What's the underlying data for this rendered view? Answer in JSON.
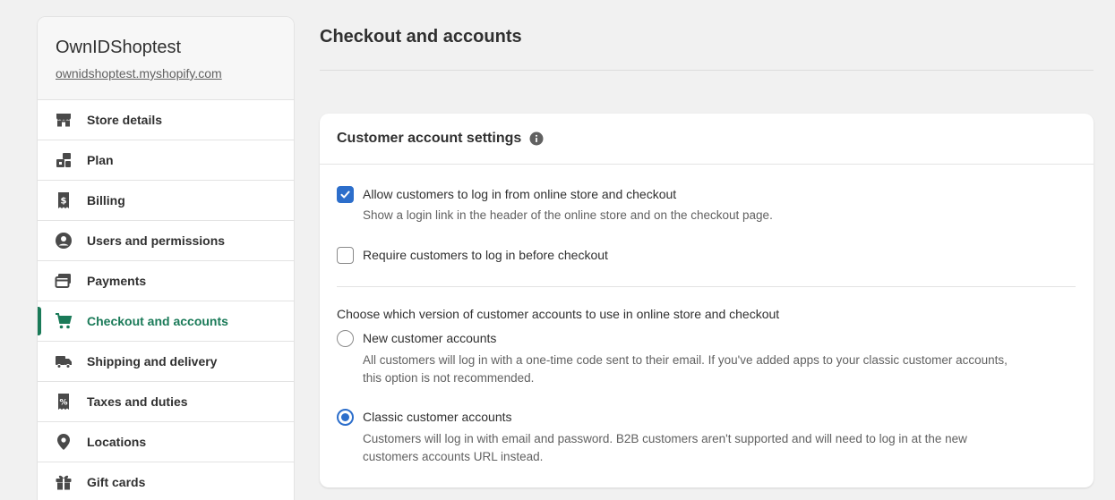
{
  "store": {
    "name": "OwnIDShoptest",
    "url": "ownidshoptest.myshopify.com"
  },
  "sidebar": {
    "items": [
      {
        "label": "Store details",
        "icon": "store-icon"
      },
      {
        "label": "Plan",
        "icon": "plan-icon"
      },
      {
        "label": "Billing",
        "icon": "billing-icon"
      },
      {
        "label": "Users and permissions",
        "icon": "user-icon"
      },
      {
        "label": "Payments",
        "icon": "payments-icon"
      },
      {
        "label": "Checkout and accounts",
        "icon": "cart-icon",
        "active": true
      },
      {
        "label": "Shipping and delivery",
        "icon": "truck-icon"
      },
      {
        "label": "Taxes and duties",
        "icon": "tax-icon"
      },
      {
        "label": "Locations",
        "icon": "location-pin-icon"
      },
      {
        "label": "Gift cards",
        "icon": "gift-icon"
      }
    ]
  },
  "page": {
    "title": "Checkout and accounts"
  },
  "card": {
    "title": "Customer account settings",
    "allow_login": {
      "label": "Allow customers to log in from online store and checkout",
      "help": "Show a login link in the header of the online store and on the checkout page.",
      "checked": true
    },
    "require_login": {
      "label": "Require customers to log in before checkout",
      "checked": false
    },
    "version_group_label": "Choose which version of customer accounts to use in online store and checkout",
    "new_accounts": {
      "label": "New customer accounts",
      "help_line1": "All customers will log in with a one-time code sent to their email. If you've added apps to your classic customer accounts,",
      "help_line2": "this option is not recommended.",
      "selected": false
    },
    "classic_accounts": {
      "label": "Classic customer accounts",
      "help_line1": "Customers will log in with email and password. B2B customers aren't supported and will need to log in at the new",
      "help_line2": "customers accounts URL instead.",
      "selected": true
    }
  },
  "colors": {
    "accent_green": "#1a7a58",
    "primary_blue": "#2c6ecb",
    "background": "#f1f1f1"
  }
}
